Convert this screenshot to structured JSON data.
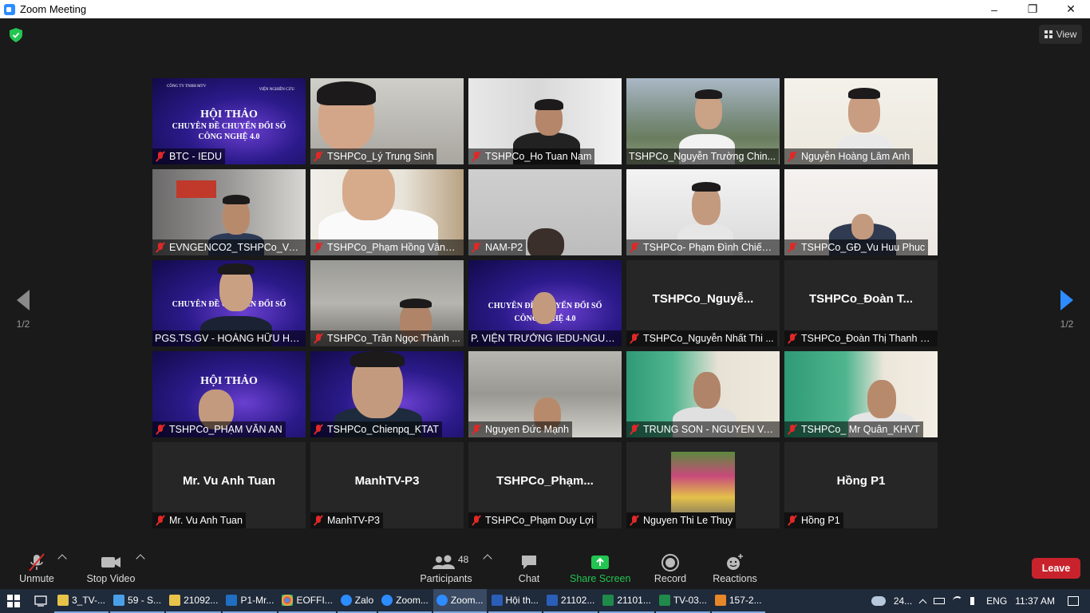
{
  "window": {
    "title": "Zoom Meeting"
  },
  "view_label": "View",
  "pager": {
    "left": "1/2",
    "right": "1/2"
  },
  "tiles": [
    {
      "label": "BTC - IEDU"
    },
    {
      "label": "TSHPCo_Lý Trung Sinh"
    },
    {
      "label": "TSHPCo_Ho Tuan Nam"
    },
    {
      "label": "TSHPCo_Nguyễn Trường Chin..."
    },
    {
      "label": "Nguyễn Hoàng Lâm Anh"
    },
    {
      "label": "EVNGENCO2_TSHPCo_Vu ..."
    },
    {
      "label": "TSHPCo_Phạm Hồng Vân_K..."
    },
    {
      "label": "NAM-P2"
    },
    {
      "label": "TSHPCo- Phạm Đình Chiến ..."
    },
    {
      "label": "TSHPCo_GĐ_Vu Huu Phuc"
    },
    {
      "label": "PGS.TS.GV - HOÀNG HỮU HẠ..."
    },
    {
      "label": "TSHPCo_Trần Ngọc Thành ..."
    },
    {
      "label": "P. VIỆN TRƯỞNG IEDU-NGUY..."
    },
    {
      "label": "TSHPCo_Nguyễn Nhất Thi ...",
      "center": "TSHPCo_Nguyễ..."
    },
    {
      "label": "TSHPCo_Đoàn Thị Thanh N...",
      "center": "TSHPCo_Đoàn  T..."
    },
    {
      "label": "TSHPCo_PHẠM VĂN AN"
    },
    {
      "label": "TSHPCo_Chienpq_KTAT"
    },
    {
      "label": "Nguyen Đức Mạnh"
    },
    {
      "label": "TRUNG SON - NGUYEN VA..."
    },
    {
      "label": "TSHPCo_ Mr Quân_KHVT"
    },
    {
      "label": "Mr. Vu Anh Tuan",
      "center": "Mr. Vu Anh Tuan"
    },
    {
      "label": "ManhTV-P3",
      "center": "ManhTV-P3"
    },
    {
      "label": "TSHPCo_Phạm Duy Lợi",
      "center": "TSHPCo_Phạm..."
    },
    {
      "label": "Nguyen Thi Le Thuy"
    },
    {
      "label": "Hồng P1",
      "center": "Hồng P1"
    }
  ],
  "banner": {
    "company": "CÔNG TY TNHH MTV THỦY ĐIỆN TRUNG SƠN",
    "institute": "VIỆN NGHIÊN CỨU ĐÀO TẠO NHÂN LỰC VÀ PHÁT TRIỂN GIÁO DỤC",
    "line1": "HỘI THẢO",
    "line2": "CHUYÊN ĐỀ CHUYỂN ĐỔI SỐ",
    "line3": "CÔNG NGHỆ 4.0"
  },
  "toolbar": {
    "unmute": "Unmute",
    "stop_video": "Stop Video",
    "participants": "Participants",
    "participants_count": "48",
    "chat": "Chat",
    "share_screen": "Share Screen",
    "record": "Record",
    "reactions": "Reactions",
    "leave": "Leave"
  },
  "taskbar": {
    "items": [
      "3_TV-...",
      "59 - S...",
      "21092...",
      "P1-Mr...",
      "EOFFI...",
      "Zalo",
      "Zoom...",
      "Zoom...",
      "Hội th...",
      "21102...",
      "21101...",
      "TV-03...",
      "157-2..."
    ],
    "temp": "24...",
    "lang": "ENG",
    "time": "11:37 AM"
  },
  "colors": {
    "accent": "#2d8cff",
    "leave": "#c8232c",
    "share": "#23c552",
    "active_speaker": "#c6e14a"
  }
}
